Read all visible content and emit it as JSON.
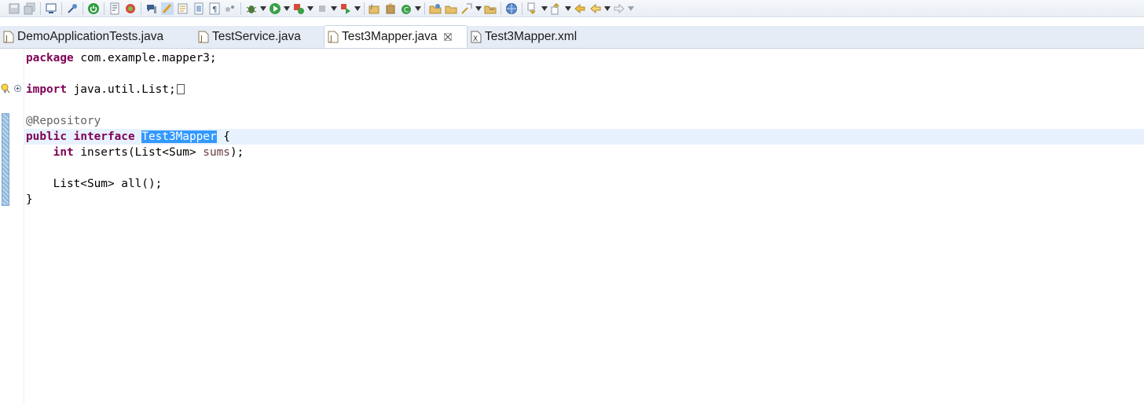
{
  "toolbar": {
    "icons": [
      "save-icon",
      "save-all-icon",
      "console-icon",
      "pin-icon",
      "spring-boot-icon",
      "outline-icon",
      "debug-stop-icon",
      "quick-access-icon",
      "highlight-icon",
      "toggle-mark-icon",
      "block-select-icon",
      "show-whitespace-icon",
      "breadcrumb-icon",
      "debug-icon",
      "run-icon",
      "coverage-icon",
      "terminate-icon",
      "external-tools-icon",
      "new-java-project-icon",
      "new-package-icon",
      "new-class-icon",
      "open-type-icon",
      "open-task-icon",
      "search-icon",
      "open-perspective-icon",
      "globe-icon",
      "next-annotation-icon",
      "previous-annotation-icon",
      "last-edit-icon",
      "back-icon",
      "forward-icon"
    ]
  },
  "tabs": [
    {
      "label": "DemoApplicationTests.java",
      "icon": "java-file-icon",
      "active": false
    },
    {
      "label": "TestService.java",
      "icon": "java-file-icon",
      "active": false
    },
    {
      "label": "Test3Mapper.java",
      "icon": "java-file-icon",
      "active": true
    },
    {
      "label": "Test3Mapper.xml",
      "icon": "xml-file-icon",
      "active": false
    }
  ],
  "code": {
    "line1_kw": "package",
    "line1_rest": " com.example.mapper3;",
    "line3_kw": "import",
    "line3_rest": " java.util.List;",
    "line5": "@Repository",
    "line6_kw1": "public",
    "line6_kw2": "interface",
    "line6_name": "Test3Mapper",
    "line6_rest": " {",
    "line7_indent": "    ",
    "line7_kw": "int",
    "line7_mid": " inserts(List<Sum> ",
    "line7_param": "sums",
    "line7_end": ");",
    "line9": "    List<Sum> all();",
    "line10": "}"
  },
  "colors": {
    "keyword": "#7f0055",
    "annotation": "#646464",
    "parameter": "#6a3e3e",
    "selection": "#3399ff",
    "current_line": "#e8f2fe"
  }
}
